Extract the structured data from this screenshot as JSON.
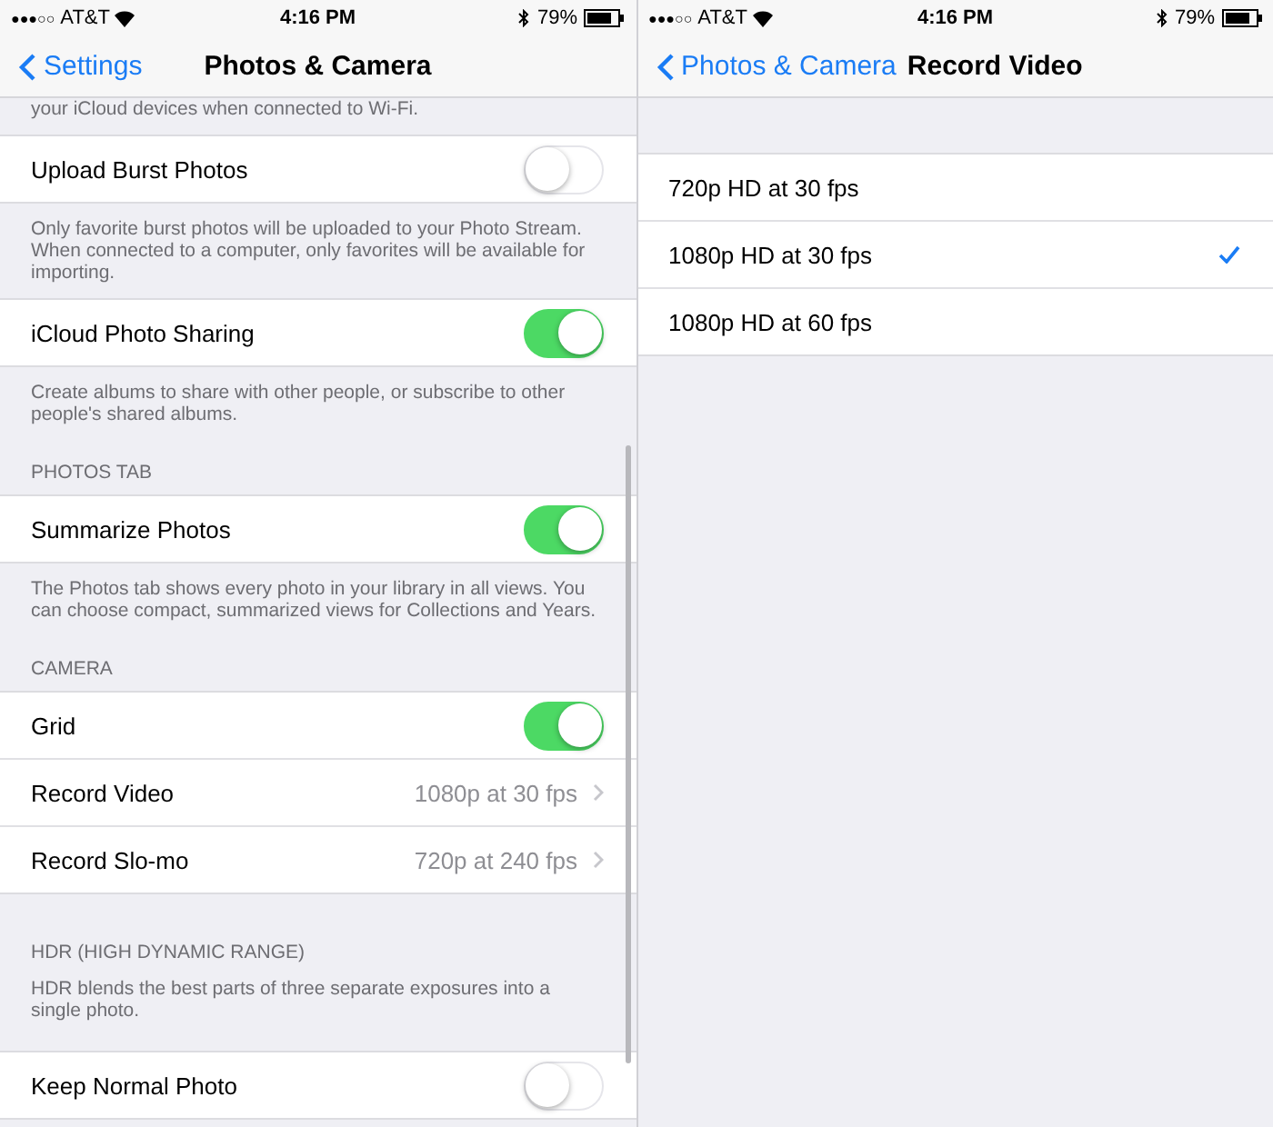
{
  "left_screen": {
    "status_bar": {
      "signal": "●●●○○",
      "carrier": "AT&T",
      "time": "4:16 PM",
      "battery": "79%"
    },
    "nav": {
      "back": "Settings",
      "title": "Photos & Camera"
    },
    "top_footer": "your iCloud devices when connected to Wi-Fi.",
    "sections": [
      {
        "rows": [
          {
            "kind": "toggle",
            "label": "Upload Burst Photos",
            "on": false
          }
        ],
        "footer": "Only favorite burst photos will be uploaded to your Photo Stream. When connected to a computer, only favorites will be available for importing."
      },
      {
        "rows": [
          {
            "kind": "toggle",
            "label": "iCloud Photo Sharing",
            "on": true
          }
        ],
        "footer": "Create albums to share with other people, or subscribe to other people's shared albums."
      },
      {
        "header": "PHOTOS TAB",
        "rows": [
          {
            "kind": "toggle",
            "label": "Summarize Photos",
            "on": true
          }
        ],
        "footer": "The Photos tab shows every photo in your library in all views. You can choose compact, summarized views for Collections and Years."
      },
      {
        "header": "CAMERA",
        "rows": [
          {
            "kind": "toggle",
            "label": "Grid",
            "on": true
          },
          {
            "kind": "detail",
            "label": "Record Video",
            "value": "1080p at 30 fps"
          },
          {
            "kind": "detail",
            "label": "Record Slo-mo",
            "value": "720p at 240 fps"
          }
        ]
      },
      {
        "header": "HDR (HIGH DYNAMIC RANGE)",
        "rows": [
          {
            "kind": "toggle",
            "label": "Keep Normal Photo",
            "on": false
          }
        ],
        "footer_before": "HDR blends the best parts of three separate exposures into a single photo."
      }
    ]
  },
  "right_screen": {
    "status_bar": {
      "signal": "●●●○○",
      "carrier": "AT&T",
      "time": "4:16 PM",
      "battery": "79%"
    },
    "nav": {
      "back": "Photos & Camera",
      "title": "Record Video"
    },
    "options": [
      {
        "label": "720p HD at 30 fps",
        "selected": false
      },
      {
        "label": "1080p HD at 30 fps",
        "selected": true
      },
      {
        "label": "1080p HD at 60 fps",
        "selected": false
      }
    ]
  }
}
